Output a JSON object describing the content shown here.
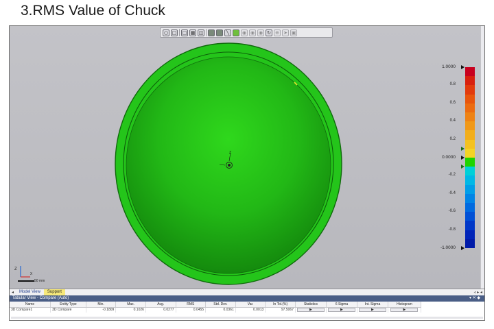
{
  "slide": {
    "title": "3.RMS Value of Chuck"
  },
  "toolbar": {
    "icons": [
      "view-cube-icon",
      "box-icon",
      "select-icon",
      "layout-icon",
      "panel-icon",
      "grid-icon",
      "grid-alt-icon",
      "line-icon",
      "green-square-icon",
      "circle-tool-icon",
      "circle-tool-2-icon",
      "circle-tool-3-icon",
      "refresh-icon",
      "crosshair-icon",
      "cursor-icon",
      "lock-icon"
    ]
  },
  "color_scale": {
    "labels": [
      {
        "text": "1.0000",
        "value": 1.0,
        "big": true
      },
      {
        "text": "0.8",
        "value": 0.8
      },
      {
        "text": "0.6",
        "value": 0.6
      },
      {
        "text": "0.4",
        "value": 0.4
      },
      {
        "text": "0.2",
        "value": 0.2
      },
      {
        "text": "0.0000",
        "value": 0.0,
        "big": true
      },
      {
        "text": "-0.2",
        "value": -0.2
      },
      {
        "text": "-0.4",
        "value": -0.4
      },
      {
        "text": "-0.6",
        "value": -0.6
      },
      {
        "text": "-0.8",
        "value": -0.8
      },
      {
        "text": "-1.0000",
        "value": -1.0,
        "big": true
      }
    ],
    "colors": [
      "#c8001e",
      "#d8200e",
      "#e23a0c",
      "#e8550c",
      "#ec6b10",
      "#ee8214",
      "#f09818",
      "#f2ae1c",
      "#f4c220",
      "#f4d426",
      "#1fd400",
      "#00d0d8",
      "#00b8e6",
      "#009ee8",
      "#0084e6",
      "#006ae0",
      "#0050d6",
      "#0038c8",
      "#0024b8",
      "#001aa8"
    ],
    "upper_tolerance": 0.1,
    "lower_tolerance": -0.1
  },
  "axes": {
    "x": "X",
    "z": "Z"
  },
  "scalebar": {
    "label": "50 mm"
  },
  "bottom_tabs": {
    "items": [
      {
        "label": "Model View",
        "active": false
      },
      {
        "label": "Support",
        "active": true
      }
    ],
    "controls": "◃ ▸ ◂"
  },
  "tabular": {
    "title": "Tabular View - Compare (Auto)",
    "controls": "▾ ✕ ◆",
    "columns": [
      "Name",
      "Entity Type",
      "Min.",
      "Max.",
      "Avg.",
      "RMS",
      "Std. Dev.",
      "Var.",
      "In Tol.(%)",
      "Statistics",
      "6 Sigma",
      "Int. Sigma",
      "Histogram"
    ],
    "rows": [
      {
        "name": "3D Compare1",
        "type": "3D Compare",
        "min": "-0.1809",
        "max": "0.1026",
        "avg": "0.0277",
        "rms": "0.0455",
        "std": "0.0361",
        "var": "0.0013",
        "intol": "97.5067",
        "statistics": "▶",
        "six_sigma": "▶",
        "int_sigma": "▶",
        "histogram": "▶"
      }
    ]
  }
}
